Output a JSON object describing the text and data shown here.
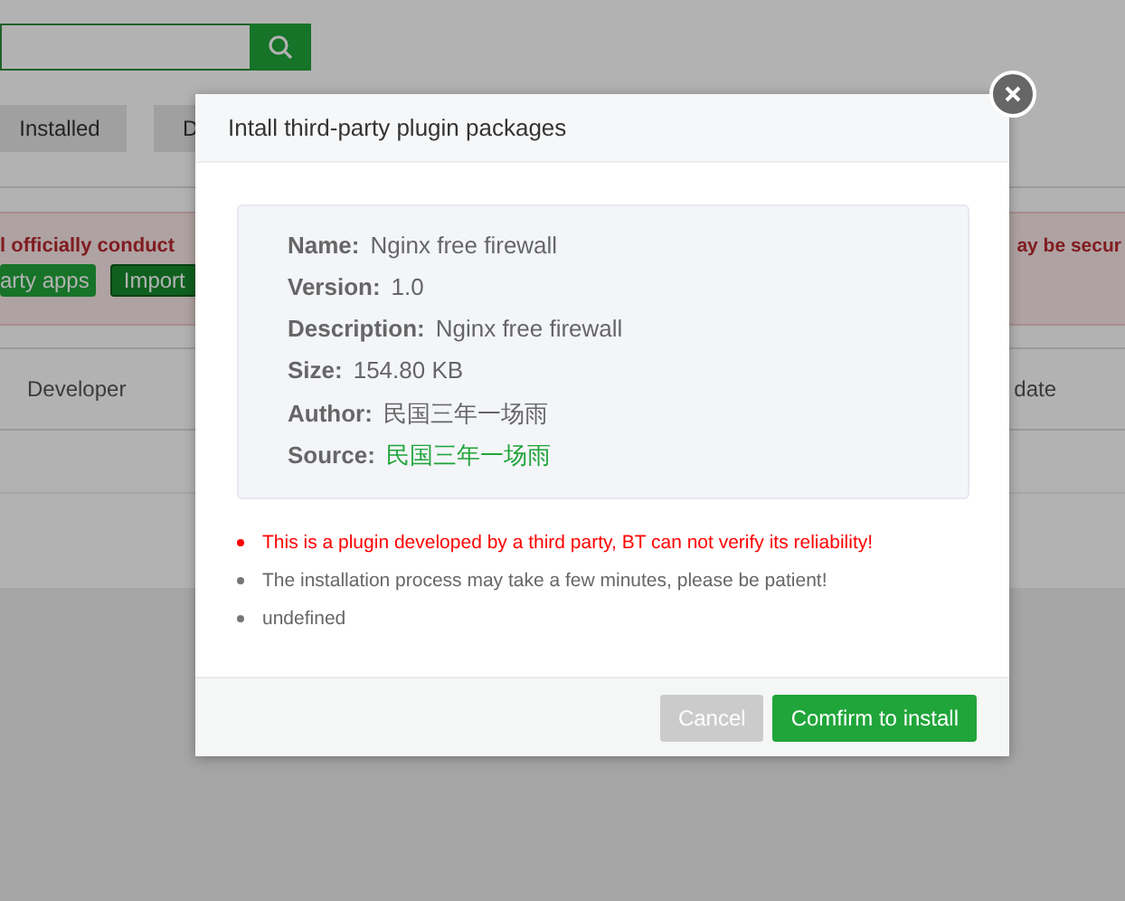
{
  "page": {
    "tabs": [
      {
        "label": "Installed",
        "selected": false
      },
      {
        "label": "D",
        "selected": false
      }
    ],
    "alert": {
      "text_left": "l officially conduct",
      "text_right": "ay be secur",
      "buttons": [
        "arty apps",
        "Import"
      ]
    },
    "table": {
      "columns": [
        "Developer",
        "date"
      ]
    }
  },
  "dialog": {
    "title": "Intall third-party plugin packages",
    "fields": [
      {
        "label": "Name:",
        "value": "Nginx free firewall",
        "kind": "plain"
      },
      {
        "label": "Version:",
        "value": "1.0",
        "kind": "plain"
      },
      {
        "label": "Description:",
        "value": "Nginx free firewall",
        "kind": "plain"
      },
      {
        "label": "Size:",
        "value": "154.80 KB",
        "kind": "plain"
      },
      {
        "label": "Author:",
        "value": "民国三年一场雨",
        "kind": "plain"
      },
      {
        "label": "Source:",
        "value": "民国三年一场雨",
        "kind": "link"
      }
    ],
    "notes": [
      {
        "text": "This is a plugin developed by a third party, BT can not verify its reliability!",
        "kind": "warning"
      },
      {
        "text": "The installation process may take a few minutes, please be patient!",
        "kind": "info"
      },
      {
        "text": "undefined",
        "kind": "info"
      }
    ],
    "buttons": [
      {
        "label": "Cancel",
        "kind": "secondary"
      },
      {
        "label": "Comfirm to install",
        "kind": "primary"
      }
    ]
  }
}
